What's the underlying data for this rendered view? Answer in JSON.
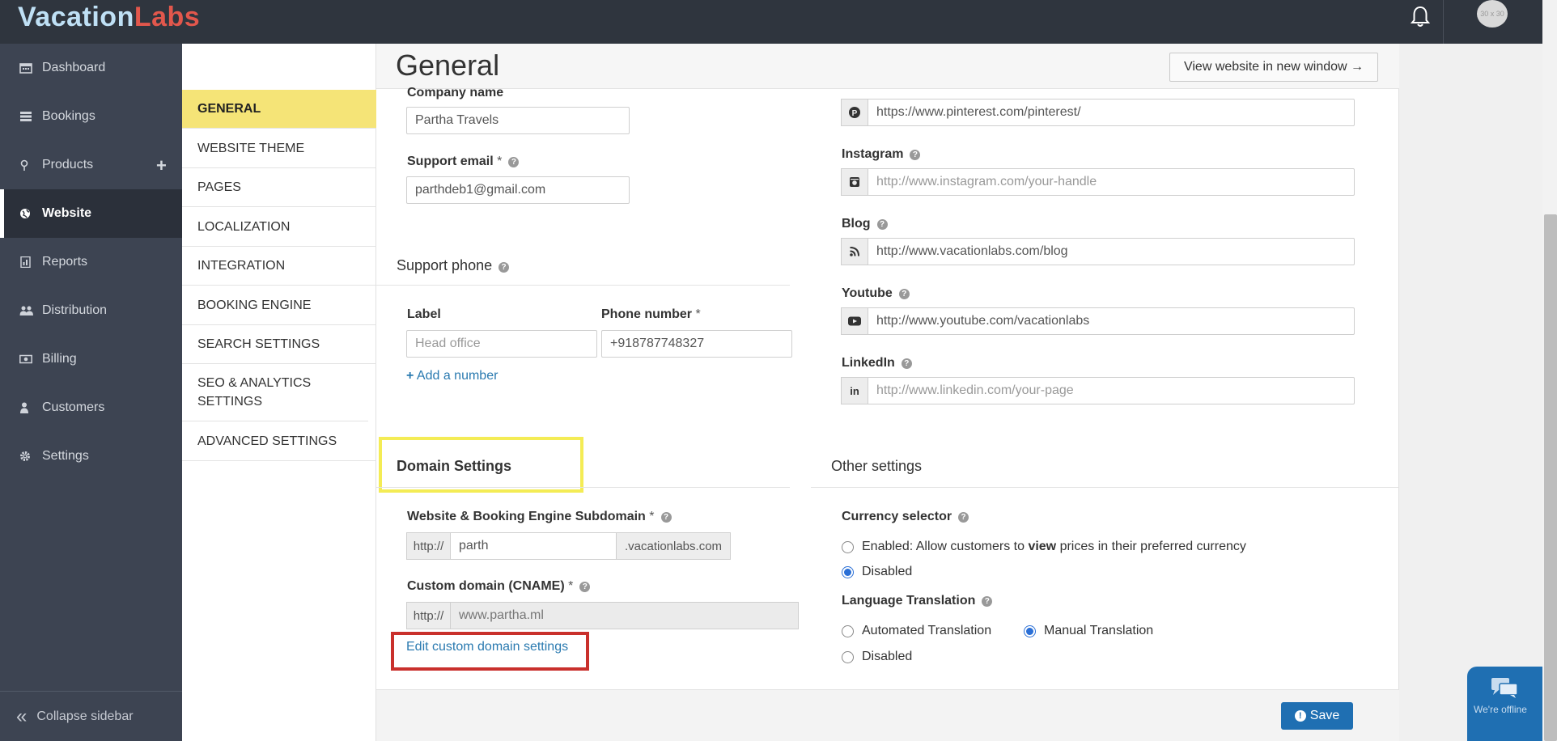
{
  "header": {
    "logo_part1": "Vacation",
    "logo_part2": "Labs",
    "avatar_text": "30 x 30"
  },
  "sidebar": {
    "items": [
      {
        "label": "Dashboard",
        "icon": "calendar-icon"
      },
      {
        "label": "Bookings",
        "icon": "list-icon"
      },
      {
        "label": "Products",
        "icon": "map-marker-icon"
      },
      {
        "label": "Website",
        "icon": "globe-icon"
      },
      {
        "label": "Reports",
        "icon": "report-icon"
      },
      {
        "label": "Distribution",
        "icon": "users-icon"
      },
      {
        "label": "Billing",
        "icon": "money-icon"
      },
      {
        "label": "Customers",
        "icon": "user-icon"
      },
      {
        "label": "Settings",
        "icon": "gear-icon"
      }
    ],
    "products_plus": "+",
    "collapse_label": "Collapse sidebar"
  },
  "submenu": {
    "items": [
      "GENERAL",
      "WEBSITE THEME",
      "PAGES",
      "LOCALIZATION",
      "INTEGRATION",
      "BOOKING ENGINE",
      "SEARCH SETTINGS",
      "SEO & ANALYTICS SETTINGS",
      "ADVANCED SETTINGS"
    ]
  },
  "page": {
    "title": "General",
    "view_website_label": "View website in new window →"
  },
  "company": {
    "name_label": "Company name",
    "name_value": "Partha Travels",
    "email_label": "Support email",
    "email_value": "parthdeb1@gmail.com",
    "required_mark": "*"
  },
  "phone": {
    "heading": "Support phone",
    "label_label": "Label",
    "label_placeholder": "Head office",
    "number_label": "Phone number",
    "number_value": "+918787748327",
    "add_link": "Add a number"
  },
  "social": {
    "pinterest_value": "https://www.pinterest.com/pinterest/",
    "instagram_label": "Instagram",
    "instagram_placeholder": "http://www.instagram.com/your-handle",
    "blog_label": "Blog",
    "blog_value": "http://www.vacationlabs.com/blog",
    "youtube_label": "Youtube",
    "youtube_value": "http://www.youtube.com/vacationlabs",
    "linkedin_label": "LinkedIn",
    "linkedin_placeholder": "http://www.linkedin.com/your-page"
  },
  "domain": {
    "heading": "Domain Settings",
    "subdomain_label": "Website & Booking Engine Subdomain",
    "prefix": "http://",
    "subdomain_value": "parth",
    "suffix": ".vacationlabs.com",
    "cname_label": "Custom domain (CNAME)",
    "cname_value": "www.partha.ml",
    "edit_link": "Edit custom domain settings"
  },
  "other": {
    "heading": "Other settings",
    "currency_label": "Currency selector",
    "currency_enabled_pre": "Enabled: Allow customers to ",
    "currency_enabled_bold": "view",
    "currency_enabled_post": " prices in their preferred currency",
    "currency_disabled": "Disabled",
    "currency_selected": "Disabled",
    "language_label": "Language Translation",
    "lang_auto": "Automated Translation",
    "lang_manual": "Manual Translation",
    "lang_disabled": "Disabled",
    "lang_selected": "Manual Translation"
  },
  "footer": {
    "save_label": "Save",
    "chat_text": "We're offline"
  },
  "colors": {
    "sidebar_bg": "#3d4452",
    "topbar_bg": "#2f353e",
    "active_submenu": "#f5e477",
    "primary_button": "#1f6fb2",
    "highlight_yellow": "#f4ec55",
    "highlight_red": "#c9302c"
  }
}
